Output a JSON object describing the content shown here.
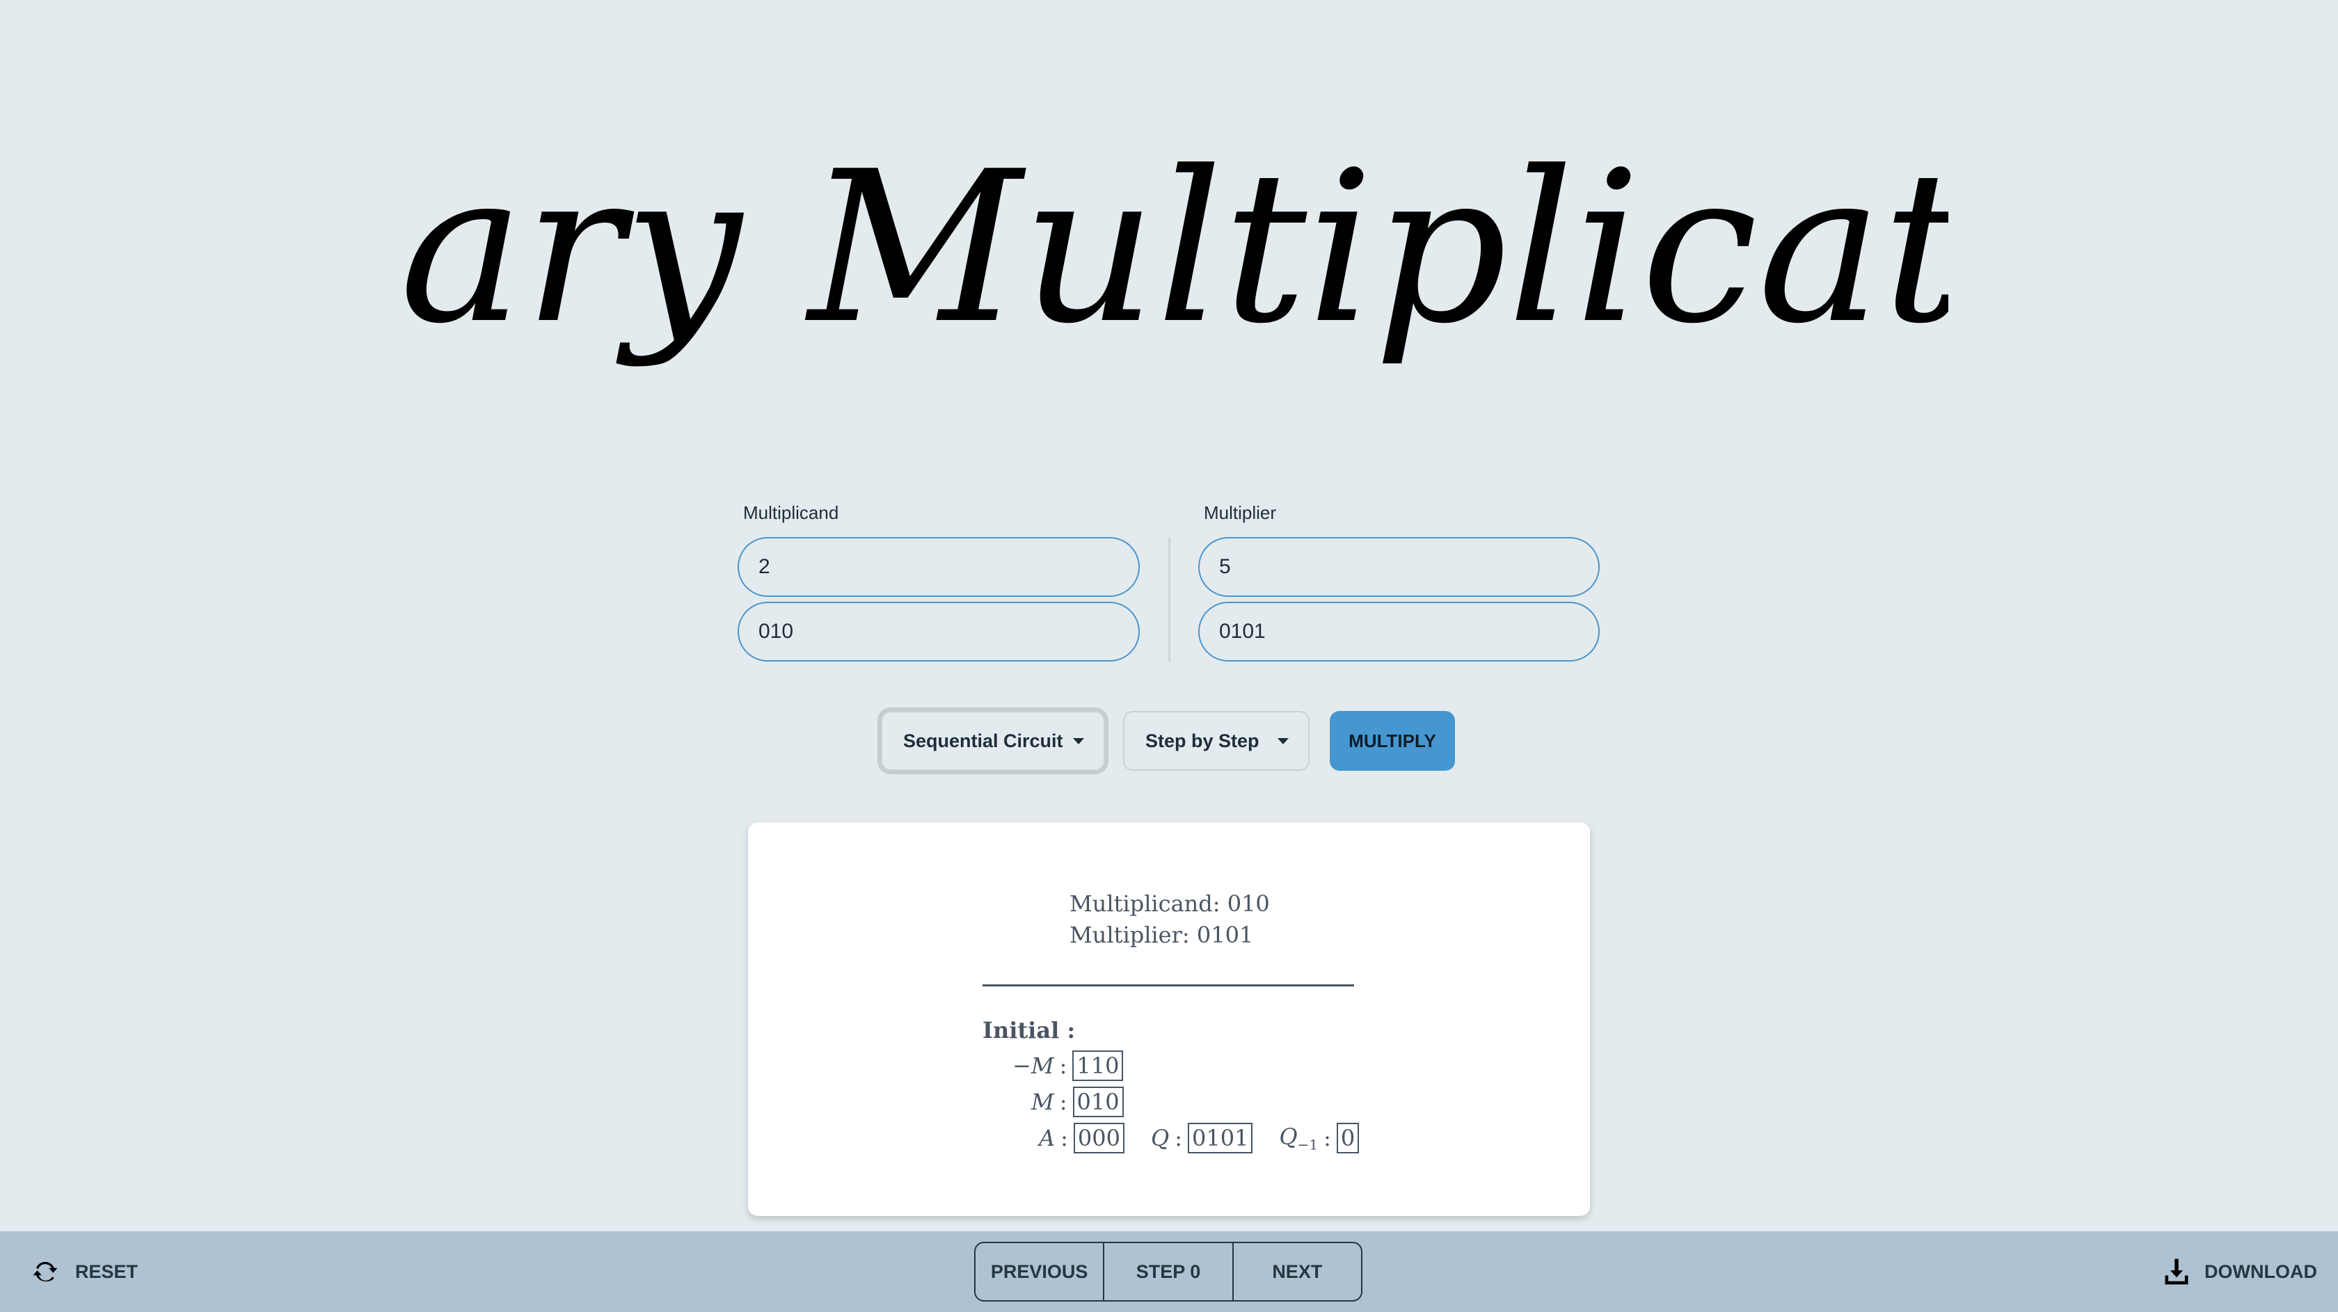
{
  "title": "Binary Multiplication",
  "inputs": {
    "multiplicand": {
      "label": "Multiplicand",
      "decimal": "2",
      "binary": "010"
    },
    "multiplier": {
      "label": "Multiplier",
      "decimal": "5",
      "binary": "0101"
    }
  },
  "controls": {
    "method_select": "Sequential Circuit",
    "mode_select": "Step by Step",
    "multiply_label": "MULTIPLY"
  },
  "result": {
    "multiplicand_line": "Multiplicand: 010",
    "multiplier_line": "Multiplier: 0101",
    "step_title": "Initial :",
    "neg_m_label": "−M",
    "neg_m_value": "110",
    "m_label": "M",
    "m_value": "010",
    "a_label": "A",
    "a_value": "000",
    "q_label": "Q",
    "q_value": "0101",
    "q_minus1_label": "Q",
    "q_minus1_sub": "−1",
    "q_minus1_value": "0",
    "colon": ":"
  },
  "footer": {
    "reset_label": "RESET",
    "previous_label": "PREVIOUS",
    "step_label": "STEP 0",
    "next_label": "NEXT",
    "download_label": "DOWNLOAD"
  },
  "colors": {
    "background": "#e3ebef",
    "accent": "#4697cf",
    "footer": "#aec2d1"
  }
}
